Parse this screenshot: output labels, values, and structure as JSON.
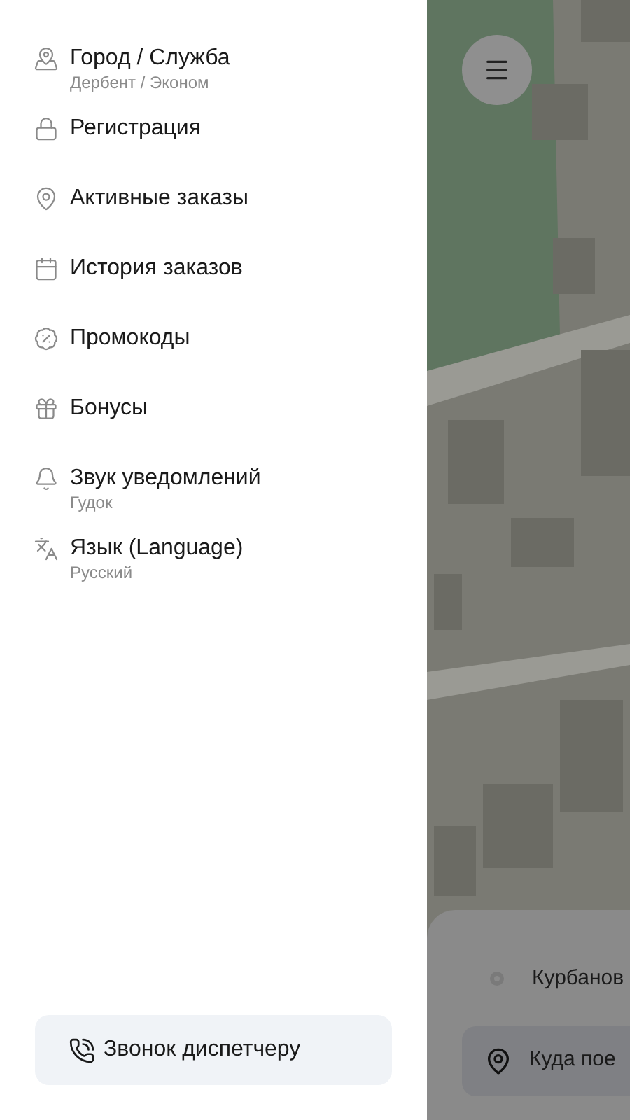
{
  "menu": [
    {
      "label": "Город / Служба",
      "sublabel": "Дербент / Эконом"
    },
    {
      "label": "Регистрация"
    },
    {
      "label": "Активные заказы"
    },
    {
      "label": "История заказов"
    },
    {
      "label": "Промокоды"
    },
    {
      "label": "Бонусы"
    },
    {
      "label": "Звук уведомлений",
      "sublabel": "Гудок"
    },
    {
      "label": "Язык (Language)",
      "sublabel": "Русский"
    }
  ],
  "call_button": "Звонок диспетчеру",
  "order_card": {
    "from": "Курбанов",
    "to_placeholder": "Куда пое"
  }
}
